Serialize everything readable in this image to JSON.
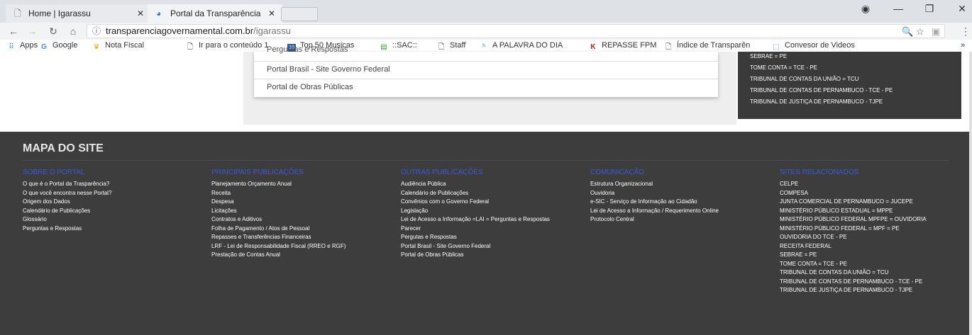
{
  "browser": {
    "tabs": [
      {
        "title": "Home | Igarassu",
        "icon": "page-icon",
        "active": false
      },
      {
        "title": "Portal da Transparência",
        "icon": "portal-favicon",
        "active": true
      }
    ],
    "url_host": "transparenciagovernamental.com.br",
    "url_path": "/igarassu",
    "bookmarks": [
      {
        "label": "Apps",
        "icon": "apps-grid-icon"
      },
      {
        "label": "Google",
        "icon": "google-icon"
      },
      {
        "label": "Nota Fiscal",
        "icon": "crown-icon"
      },
      {
        "label": "Ir para o conteúdo 1",
        "icon": "page-icon"
      },
      {
        "label": "Top 50 Musicas",
        "icon": "calendar-icon"
      },
      {
        "label": "::SAC::",
        "icon": "folder-icon"
      },
      {
        "label": "Staff",
        "icon": "page-icon"
      },
      {
        "label": "A PALAVRA DO DIA",
        "icon": "logo-icon"
      },
      {
        "label": "REPASSE FPM",
        "icon": "k-icon"
      },
      {
        "label": "Índice de Transparên",
        "icon": "page-icon"
      },
      {
        "label": "Convesor de Videos",
        "icon": "video-icon"
      }
    ],
    "more_label": "»"
  },
  "dropdown": {
    "cut_item": "Perguntas e Respostas",
    "items": [
      "Portal Brasil - Site Governo Federal",
      "Portal de Obras Públicas"
    ]
  },
  "related_box": {
    "items": [
      "SEBRAE = PE",
      "TOME CONTA = TCE - PE",
      "TRIBUNAL DE CONTAS DA UNIÃO = TCU",
      "TRIBUNAL DE CONTAS DE PERNAMBUCO - TCE - PE",
      "TRIBUNAL DE JUSTIÇA DE PERNAMBUCO - TJPE"
    ]
  },
  "footer": {
    "title": "MAPA DO SITE",
    "columns": [
      {
        "heading": "SOBRE O PORTAL",
        "items": [
          "O que é o Portal da Trasparência?",
          "O que você encontra nesse Portal?",
          "Origem dos Dados",
          "Calendário de Publicações",
          "Glossário",
          "Perguntas e Respostas"
        ]
      },
      {
        "heading": "PRINCIPAIS PUBLICAÇÕES",
        "items": [
          "Planejamento Orçamento Anual",
          "Receita",
          "Despesa",
          "Licitações",
          "Contratos e Aditivos",
          "Folha de Pagamento / Atos de Pessoal",
          "Repasses e Transferências Financeiras",
          "LRF - Lei de Responsabilidade Fiscal (RREO e RGF)",
          "Prestação de Contas Anual"
        ]
      },
      {
        "heading": "OUTRAS PUBLICAÇÕES",
        "items": [
          "Audiência Pública",
          "Calendário de Publicações",
          "Convênios com o Governo Federal",
          "Legislação",
          "Lei de Acesso a Informação =LAI = Perguntas e Respostas",
          "Parecer",
          "Pergutas e Respostas",
          "Portal Brasil - Site Governo Federal",
          "Portal de Obras Públicas"
        ]
      },
      {
        "heading": "COMUNICAÇÃO",
        "items": [
          "Estrutura Organizacional",
          "Ouvidoria",
          "e-SIC - Serviço de Informação ao Cidadão",
          "Lei de Acesso a Informação / Requerimento Online",
          "Protocolo Central"
        ]
      },
      {
        "heading": "SITES RELACIONADOS",
        "items": [
          "CELPE",
          "COMPESA",
          "JUNTA COMERCIAL DE PERNAMBUCO = JUCEPE",
          "MINISTÉRIO PÚBLICO ESTADUAL = MPPE",
          "MINISTÉRIO PÚBLICO FEDERAL MPFPE = OUVIDORIA",
          "MINISTÉRIO PÚBLICO FEDERAL = MPF = PE",
          "OUVIDORIA DO TCE - PE",
          "RECEITA FEDERAL",
          "SEBRAE = PE",
          "TOME CONTA = TCE - PE",
          "TRIBUNAL DE CONTAS DA UNIÃO = TCU",
          "TRIBUNAL DE CONTAS DE PERNAMBUCO - TCE - PE",
          "TRIBUNAL DE JUSTIÇA DE PERNAMBUCO - TJPE"
        ]
      }
    ]
  }
}
